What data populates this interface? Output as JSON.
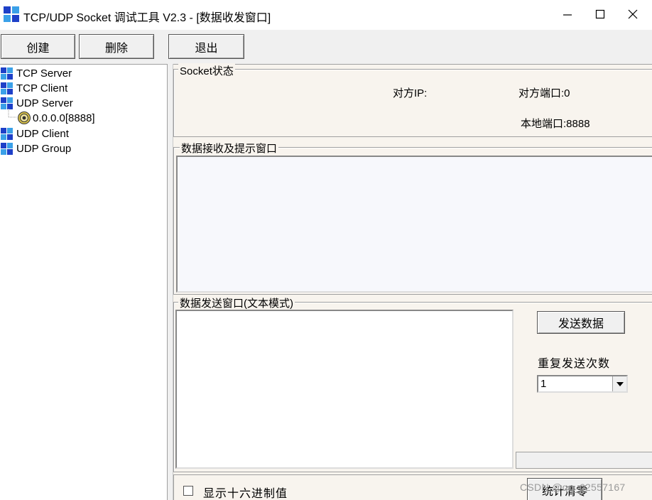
{
  "window": {
    "title": "TCP/UDP Socket 调试工具 V2.3  - [数据收发窗口]",
    "icon": "app-grid-icon",
    "minimize_icon": "minimize-icon",
    "maximize_icon": "maximize-icon",
    "close_icon": "close-icon"
  },
  "toolbar": {
    "create_label": "创建",
    "delete_label": "删除",
    "exit_label": "退出"
  },
  "tree": {
    "items": [
      {
        "label": "TCP Server",
        "icon": "node-grid-icon"
      },
      {
        "label": "TCP Client",
        "icon": "node-grid-icon"
      },
      {
        "label": "UDP Server",
        "icon": "node-grid-icon"
      },
      {
        "label": "0.0.0.0[8888]",
        "icon": "socket-target-icon"
      },
      {
        "label": "UDP Client",
        "icon": "node-grid-icon"
      },
      {
        "label": "UDP Group",
        "icon": "node-grid-icon"
      }
    ]
  },
  "socket_status": {
    "label": "Socket状态",
    "remote_ip": "对方IP:",
    "remote_port": "对方端口:0",
    "local_port": "本地端口:8888"
  },
  "receive": {
    "label": "数据接收及提示窗口",
    "content": ""
  },
  "send": {
    "label": "数据发送窗口(文本模式)",
    "content": "",
    "send_button": "发送数据",
    "repeat_label": "重复发送次数",
    "repeat_value": "1",
    "hex_label": "显示十六进制值",
    "hex_checked": false,
    "stats_button": "统计清零"
  },
  "watermark": "CSDN @qq_62557167",
  "colors": {
    "panel_bg": "#f8f4ee",
    "icon_blue": "#1e40c8",
    "icon_cyan": "#3aa0e8",
    "window_bg": "#f0f0f0"
  }
}
